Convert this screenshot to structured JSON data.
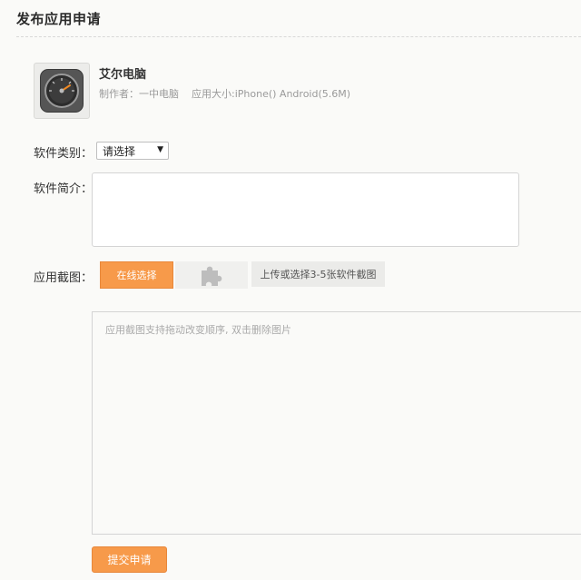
{
  "page": {
    "title": "发布应用申请"
  },
  "app": {
    "name": "艾尔电脑",
    "author_label": "制作者：",
    "author": "一中电脑",
    "size_label": "应用大小:",
    "platforms": "iPhone() Android(5.6M)"
  },
  "form": {
    "category_label": "软件类别：",
    "category_selected": "请选择",
    "desc_label": "软件简介：",
    "desc_value": "",
    "screens_label": "应用截图："
  },
  "screens": {
    "online_select_label": "在线选择",
    "upload_hint": "上传或选择3-5张软件截图",
    "dropzone_hint": "应用截图支持拖动改变顺序, 双击删除图片"
  },
  "actions": {
    "submit_label": "提交申请"
  },
  "colors": {
    "accent": "#f79a4a",
    "text": "#333333",
    "muted": "#9a9a9a"
  }
}
